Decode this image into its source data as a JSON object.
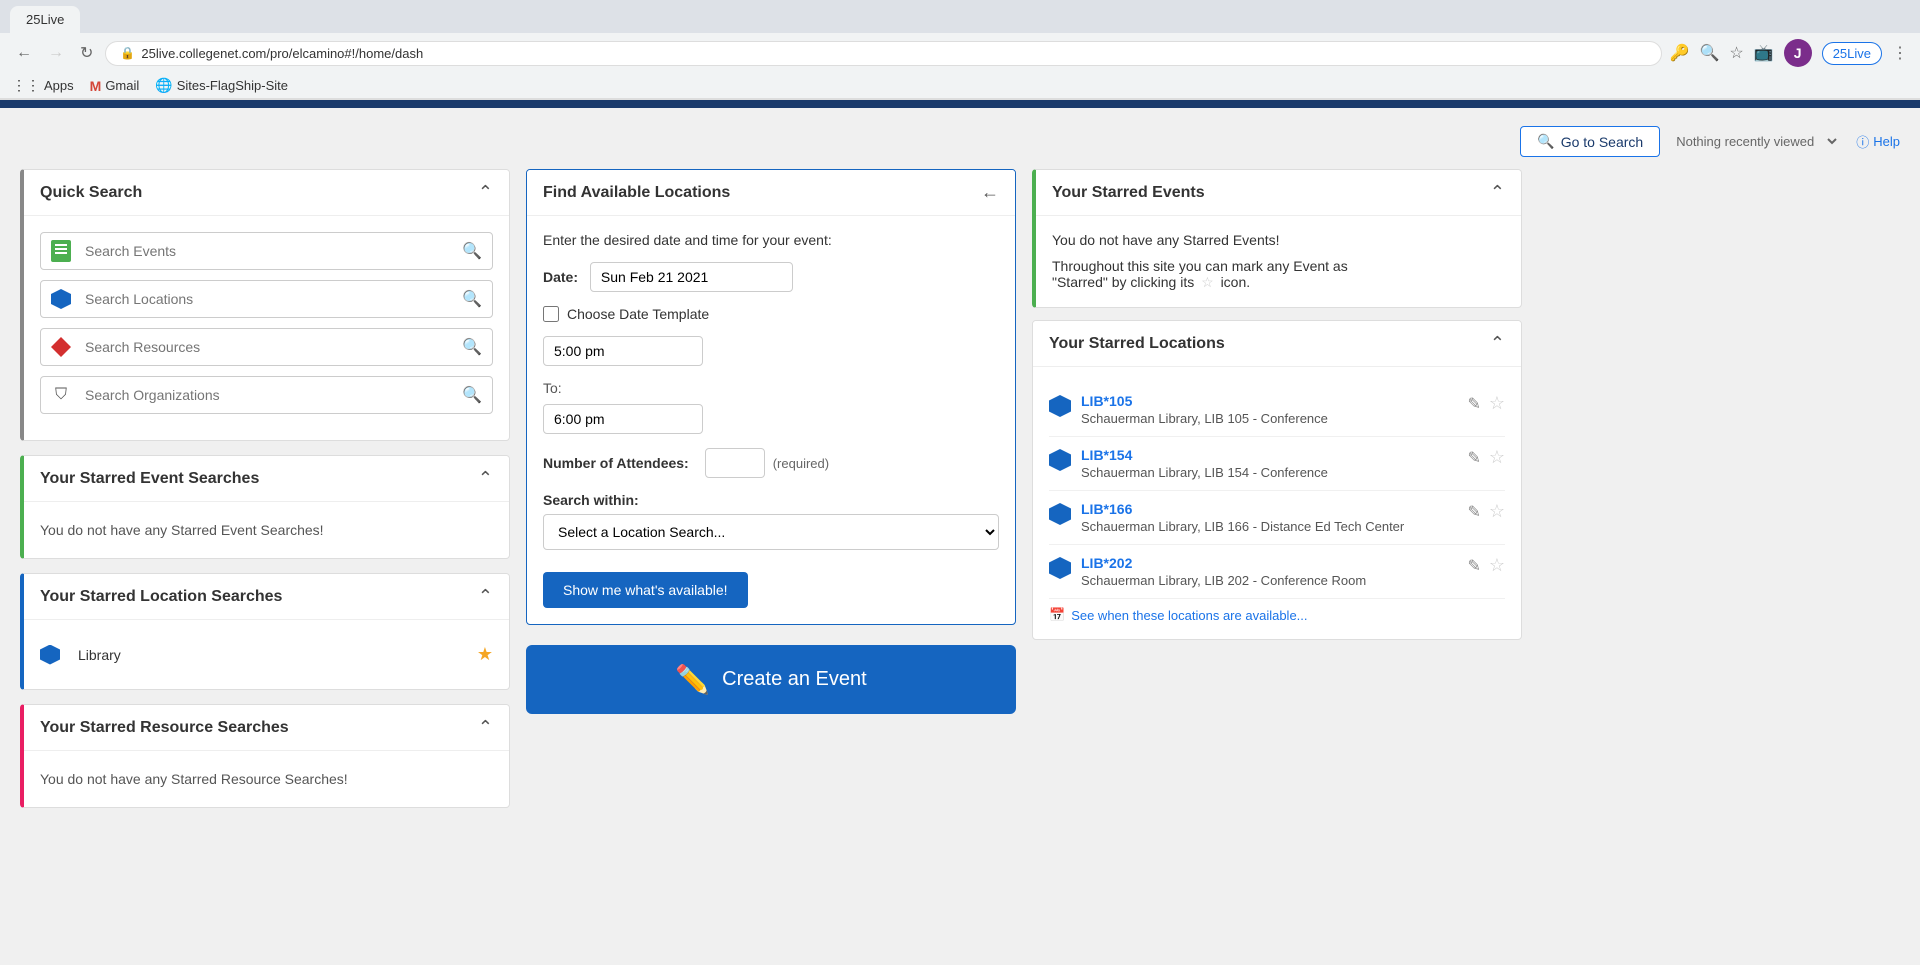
{
  "browser": {
    "url": "25live.collegenet.com/pro/elcamino#!/home/dash",
    "tab_title": "25Live",
    "back_disabled": false,
    "forward_disabled": true,
    "bookmarks": [
      {
        "label": "Apps",
        "icon": "⋮⋮"
      },
      {
        "label": "Gmail",
        "icon": "M"
      },
      {
        "label": "Sites-FlagShip-Site",
        "icon": "🌐"
      }
    ]
  },
  "topbar": {
    "go_to_search_label": "Go to Search",
    "recently_viewed_label": "Nothing recently viewed",
    "help_label": "Help"
  },
  "quick_search": {
    "title": "Quick Search",
    "search_events_placeholder": "Search Events",
    "search_locations_placeholder": "Search Locations",
    "search_resources_placeholder": "Search Resources",
    "search_organizations_placeholder": "Search Organizations"
  },
  "starred_event_searches": {
    "title": "Your Starred Event Searches",
    "empty_message": "You do not have any Starred Event Searches!"
  },
  "starred_location_searches": {
    "title": "Your Starred Location Searches",
    "item_label": "Library"
  },
  "starred_resource_searches": {
    "title": "Your Starred Resource Searches",
    "empty_message": "You do not have any Starred Resource Searches!"
  },
  "find_available_locations": {
    "title": "Find Available Locations",
    "prompt": "Enter the desired date and time for your event:",
    "date_label": "Date:",
    "date_value": "Sun Feb 21 2021",
    "choose_date_template_label": "Choose Date Template",
    "time_from_value": "5:00 pm",
    "to_label": "To:",
    "time_to_value": "6:00 pm",
    "attendees_label": "Number of Attendees:",
    "attendees_required": "(required)",
    "search_within_label": "Search within:",
    "location_select_placeholder": "Select a Location Search...",
    "show_btn_label": "Show me what's available!"
  },
  "create_event": {
    "label": "Create an Event",
    "icon": "✏️"
  },
  "starred_events": {
    "title": "Your Starred Events",
    "empty_title": "You do not have any Starred Events!",
    "empty_desc1": "Throughout this site you can mark any Event as",
    "empty_desc2": "\"Starred\" by clicking its",
    "empty_desc3": "icon."
  },
  "starred_locations": {
    "title": "Your Starred Locations",
    "items": [
      {
        "id": "LIB*105",
        "desc": "Schauerman Library, LIB 105 - Conference"
      },
      {
        "id": "LIB*154",
        "desc": "Schauerman Library, LIB 154 - Conference"
      },
      {
        "id": "LIB*166",
        "desc": "Schauerman Library, LIB 166 - Distance Ed Tech Center"
      },
      {
        "id": "LIB*202",
        "desc": "Schauerman Library, LIB 202 - Conference Room"
      }
    ],
    "see_when_label": "See when these locations are available..."
  }
}
